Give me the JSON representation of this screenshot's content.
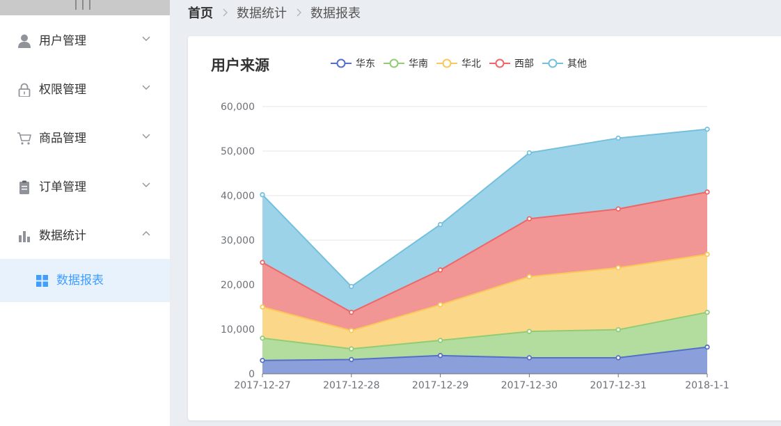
{
  "sidebar": {
    "items": [
      {
        "label": "用户管理",
        "icon": "user-icon",
        "expanded": false
      },
      {
        "label": "权限管理",
        "icon": "lock-icon",
        "expanded": false
      },
      {
        "label": "商品管理",
        "icon": "cart-icon",
        "expanded": false
      },
      {
        "label": "订单管理",
        "icon": "clipboard-icon",
        "expanded": false
      },
      {
        "label": "数据统计",
        "icon": "bar-chart-icon",
        "expanded": true
      }
    ],
    "sub_item": {
      "label": "数据报表",
      "icon": "grid-icon",
      "active": true
    }
  },
  "breadcrumb": [
    "首页",
    "数据统计",
    "数据报表"
  ],
  "colors": {
    "accent": "#409eff",
    "series": [
      "#5470c6",
      "#91cc75",
      "#fac858",
      "#ee6666",
      "#73c0de"
    ],
    "fills": [
      "#8b9fdb",
      "#b2dd9e",
      "#fbd889",
      "#f29595",
      "#9dd3e9"
    ]
  },
  "chart_data": {
    "type": "area",
    "stacked": true,
    "title": "用户来源",
    "x": [
      "2017-12-27",
      "2017-12-28",
      "2017-12-29",
      "2017-12-30",
      "2017-12-31",
      "2018-1-1"
    ],
    "series": [
      {
        "name": "华东",
        "values": [
          3000,
          3200,
          4100,
          3600,
          3600,
          6000
        ]
      },
      {
        "name": "华南",
        "values": [
          5000,
          2400,
          3400,
          5900,
          6300,
          7800
        ]
      },
      {
        "name": "华北",
        "values": [
          7000,
          4100,
          8000,
          12300,
          13900,
          13000
        ]
      },
      {
        "name": "西部",
        "values": [
          10000,
          4100,
          7800,
          13000,
          13200,
          14000
        ]
      },
      {
        "name": "其他",
        "values": [
          15200,
          5800,
          10200,
          14800,
          15900,
          14100
        ]
      }
    ],
    "y_ticks": [
      "0",
      "10,000",
      "20,000",
      "30,000",
      "40,000",
      "50,000",
      "60,000"
    ],
    "ylim": [
      0,
      60000
    ],
    "legend_position": "top",
    "grid": true
  }
}
